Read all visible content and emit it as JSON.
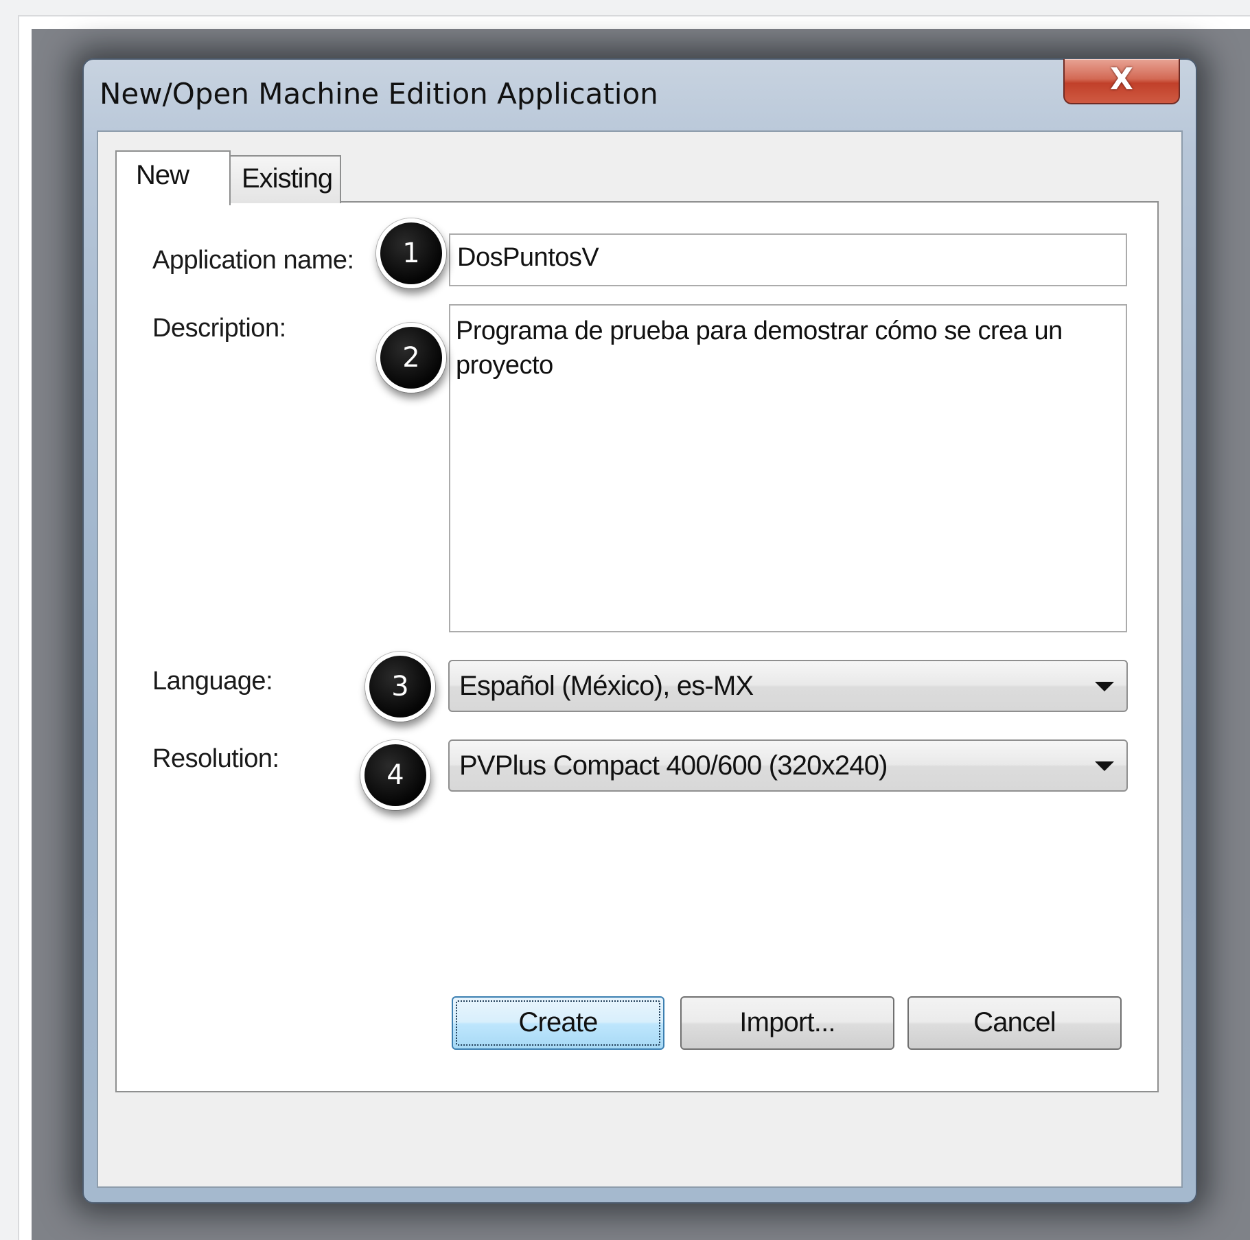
{
  "window": {
    "title": "New/Open Machine Edition Application",
    "close_label": "X"
  },
  "tabs": [
    {
      "label": "New",
      "selected": true
    },
    {
      "label": "Existing",
      "selected": false
    }
  ],
  "form": {
    "application_name": {
      "label": "Application name:",
      "value": "DosPuntosV"
    },
    "description": {
      "label": "Description:",
      "value": "Programa de prueba para demostrar cómo se crea un proyecto"
    },
    "language": {
      "label": "Language:",
      "selected": "Español (México), es-MX"
    },
    "resolution": {
      "label": "Resolution:",
      "selected": "PVPlus Compact 400/600 (320x240)"
    }
  },
  "badges": [
    "1",
    "2",
    "3",
    "4"
  ],
  "buttons": {
    "create": "Create",
    "import": "Import...",
    "cancel": "Cancel"
  },
  "colors": {
    "close_button": "#c1402a",
    "default_button": "#bee6fd",
    "badge": "#050505"
  },
  "icons": {
    "close": "close-icon",
    "dropdown": "chevron-down-icon"
  }
}
